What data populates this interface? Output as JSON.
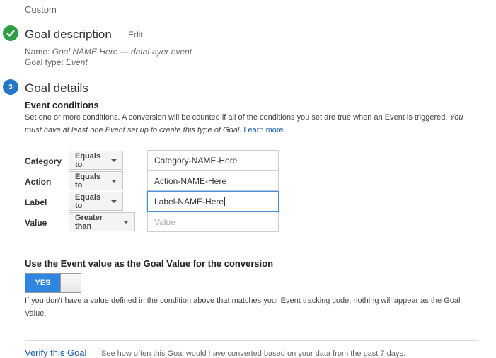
{
  "goal_setup": {
    "value": "Custom"
  },
  "goal_description": {
    "title": "Goal description",
    "edit_label": "Edit",
    "name_label": "Name:",
    "name_value": "Goal NAME Here --- dataLayer event",
    "type_label": "Goal type:",
    "type_value": "Event"
  },
  "goal_details": {
    "step_number": "3",
    "title": "Goal details",
    "event_conditions_heading": "Event conditions",
    "description": "Set one or more conditions. A conversion will be counted if all of the conditions you set are true when an Event is triggered.",
    "description_italic": "You must have at least one Event set up to create this type of Goal.",
    "learn_more": "Learn more",
    "conditions": [
      {
        "label": "Category",
        "operator": "Equals to",
        "value": "Category-NAME-Here",
        "placeholder": ""
      },
      {
        "label": "Action",
        "operator": "Equals to",
        "value": "Action-NAME-Here",
        "placeholder": ""
      },
      {
        "label": "Label",
        "operator": "Equals to",
        "value": "Label-NAME-Here",
        "placeholder": ""
      },
      {
        "label": "Value",
        "operator": "Greater than",
        "value": "",
        "placeholder": "Value"
      }
    ],
    "use_event_value_heading": "Use the Event value as the Goal Value for the conversion",
    "toggle_label": "YES",
    "toggle_state": "on",
    "note": "If you don't have a value defined in the condition above that matches your Event tracking code, nothing will appear as the Goal Value.",
    "verify_link": "Verify this Goal",
    "verify_description": "See how often this Goal would have converted based on your data from the past 7 days."
  },
  "colors": {
    "complete_green": "#2e9e44",
    "step_blue": "#2477c7",
    "toggle_blue": "#2f86e0",
    "link_blue": "#1a5ea8",
    "focus_blue": "#4a90d9"
  },
  "icons": {
    "completed_step": "check-circle-icon",
    "dropdown": "caret-down-icon"
  }
}
